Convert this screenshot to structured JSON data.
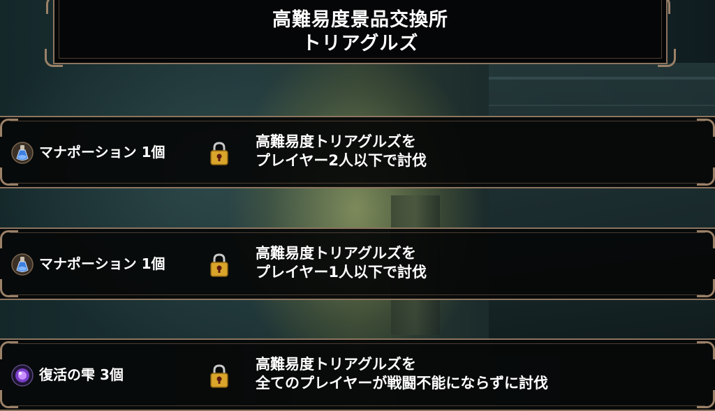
{
  "header": {
    "title_line1": "高難易度景品交換所",
    "title_line2": "トリアグルズ"
  },
  "rewards": [
    {
      "item": "マナポーション 1個",
      "icon": "mana-potion-icon",
      "locked": true,
      "condition_line1": "高難易度トリアグルズを",
      "condition_line2": "プレイヤー2人以下で討伐"
    },
    {
      "item": "マナポーション 1個",
      "icon": "mana-potion-icon",
      "locked": true,
      "condition_line1": "高難易度トリアグルズを",
      "condition_line2": "プレイヤー1人以下で討伐"
    },
    {
      "item": "復活の雫 3個",
      "icon": "revival-drop-icon",
      "locked": true,
      "condition_line1": "高難易度トリアグルズを",
      "condition_line2": "全てのプレイヤーが戦闘不能にならずに討伐"
    }
  ],
  "colors": {
    "frame": "#8c7560",
    "panel": "#060708",
    "text": "#ffffff",
    "lock_gold": "#d9a52a"
  }
}
